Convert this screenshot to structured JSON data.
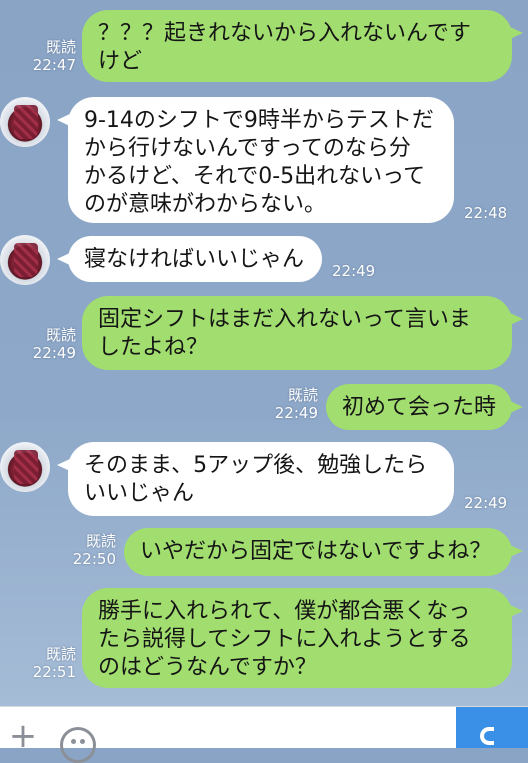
{
  "read_label": "既読",
  "messages": [
    {
      "side": "sent",
      "text": "？？？起きれないから入れないんです\nけど",
      "time": "22:47",
      "read": true
    },
    {
      "side": "recv",
      "text": "9-14のシフトで9時半からテストだ\nから行けないんですってのなら分\nかるけど、それで0-5出れないって\nのが意味がわからない。",
      "time": "22:48"
    },
    {
      "side": "recv",
      "text": "寝なければいいじゃん",
      "time": "22:49"
    },
    {
      "side": "sent",
      "text": "固定シフトはまだ入れないって言いま\nしたよね？",
      "time": "22:49",
      "read": true
    },
    {
      "side": "sent",
      "text": "初めて会った時",
      "time": "22:49",
      "read": true
    },
    {
      "side": "recv",
      "text": "そのまま、5アップ後、勉強したら\nいいじゃん",
      "time": "22:49"
    },
    {
      "side": "sent",
      "text": "いやだから固定ではないですよね？",
      "time": "22:50",
      "read": true
    },
    {
      "side": "sent",
      "text": "勝手に入れられて、僕が都合悪くなっ\nたら説得してシフトに入れようとする\nのはどうなんですか？",
      "time": "22:51",
      "read": true
    }
  ],
  "input_bar": {
    "plus_icon": "plus-icon",
    "emoji_icon": "emoji-icon",
    "call_icon": "phone-icon",
    "accent": "#3a8fe6"
  },
  "colors": {
    "sent_bubble": "#a1dd6f",
    "recv_bubble": "#ffffff",
    "background": "#8ea8c9"
  }
}
